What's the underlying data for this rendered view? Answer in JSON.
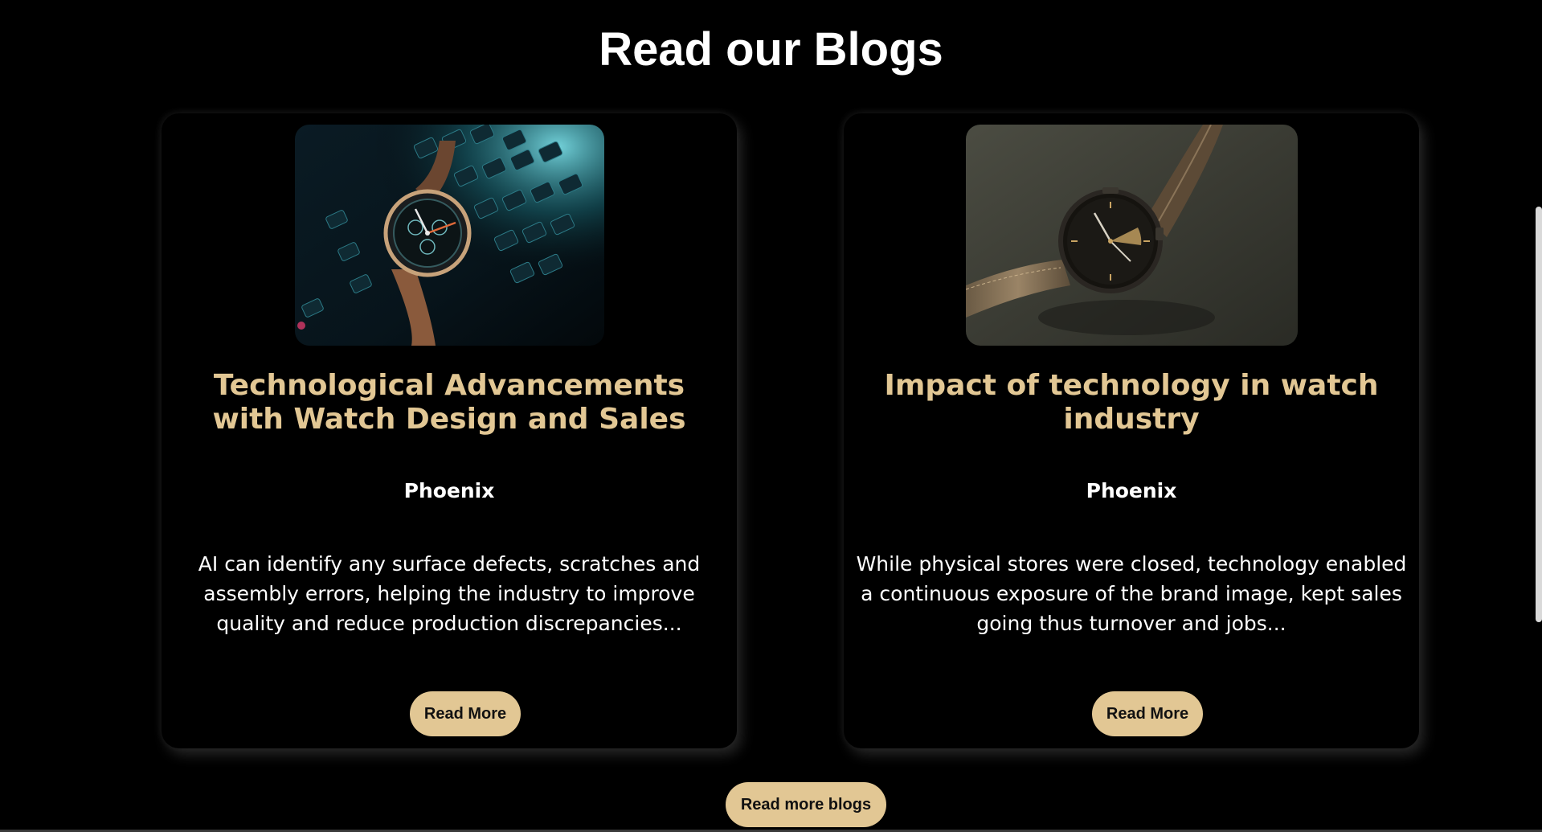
{
  "section": {
    "title": "Read our Blogs"
  },
  "cards": [
    {
      "image_alt": "watch-on-keyboard-photo",
      "title": "Technological Advancements with Watch Design and Sales",
      "author": "Phoenix",
      "excerpt": "AI can identify any surface defects, scratches and assembly errors, helping the industry to improve quality and reduce production discrepancies...",
      "button_label": "Read More"
    },
    {
      "image_alt": "leather-strap-watch-photo",
      "title": "Impact of technology in watch industry",
      "author": "Phoenix",
      "excerpt": "While physical stores were closed, technology enabled a continuous exposure of the brand image, kept sales going thus turnover and jobs...",
      "button_label": "Read More"
    }
  ],
  "footer": {
    "more_label": "Read more blogs"
  },
  "colors": {
    "background": "#000000",
    "accent": "#e2c794",
    "text": "#ffffff"
  }
}
